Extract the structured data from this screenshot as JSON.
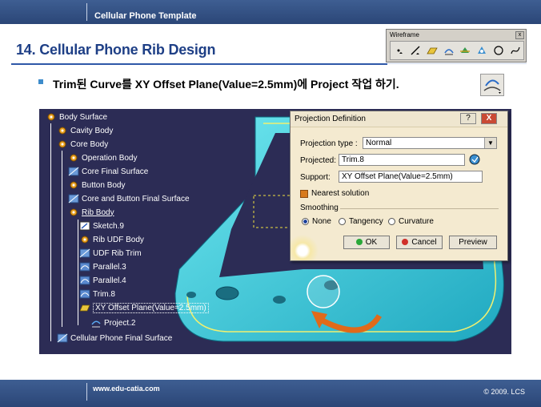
{
  "header": {
    "title": "Cellular Phone Template"
  },
  "page": {
    "heading": "14. Cellular Phone Rib Design"
  },
  "wireframe_toolbar": {
    "title": "Wireframe",
    "tools": [
      "point-icon",
      "line-icon",
      "axis-icon",
      "plane-icon",
      "projection-icon",
      "intersection-icon",
      "parallel-curve-icon",
      "circle-icon",
      "spline-icon"
    ]
  },
  "instruction": "Trim된 Curve를 XY Offset Plane(Value=2.5mm)에 Project 작업 하기.",
  "tree": {
    "items": [
      {
        "label": "Body Surface",
        "depth": 0,
        "icon": "gear-body-icon"
      },
      {
        "label": "Cavity Body",
        "depth": 1,
        "icon": "gear-body-icon"
      },
      {
        "label": "Core Body",
        "depth": 1,
        "icon": "gear-body-icon"
      },
      {
        "label": "Operation Body",
        "depth": 2,
        "icon": "gear-body-icon"
      },
      {
        "label": "Core Final Surface",
        "depth": 2,
        "icon": "surface-icon"
      },
      {
        "label": "Button Body",
        "depth": 2,
        "icon": "gear-body-icon"
      },
      {
        "label": "Core and Button Final Surface",
        "depth": 2,
        "icon": "surface-icon"
      },
      {
        "label": "Rib Body",
        "depth": 2,
        "icon": "gear-body-icon",
        "underline": true
      },
      {
        "label": "Sketch.9",
        "depth": 3,
        "icon": "sketch-icon"
      },
      {
        "label": "Rib UDF Body",
        "depth": 3,
        "icon": "gear-body-icon"
      },
      {
        "label": "UDF Rib Trim",
        "depth": 3,
        "icon": "surface-icon"
      },
      {
        "label": "Parallel.3",
        "depth": 3,
        "icon": "curve-icon"
      },
      {
        "label": "Parallel.4",
        "depth": 3,
        "icon": "curve-icon"
      },
      {
        "label": "Trim.8",
        "depth": 3,
        "icon": "curve-icon"
      },
      {
        "label": "XY Offset Plane(Value=2.5mm)",
        "depth": 3,
        "icon": "plane-icon",
        "boxed": true
      },
      {
        "label": "Project.2",
        "depth": 3,
        "icon": "projection-icon"
      },
      {
        "label": "Cellular Phone Final Surface",
        "depth": 1,
        "icon": "surface-icon"
      }
    ]
  },
  "dialog": {
    "title": "Projection Definition",
    "help_label": "?",
    "close_label": "X",
    "projection_type_label": "Projection type :",
    "projection_type_value": "Normal",
    "projected_label": "Projected:",
    "projected_value": "Trim.8",
    "support_label": "Support:",
    "support_value": "XY Offset Plane(Value=2.5mm)",
    "nearest_label": "Nearest solution",
    "smoothing_label": "Smoothing",
    "smoothing_options": [
      "None",
      "Tangency",
      "Curvature"
    ],
    "smoothing_selected": "None",
    "ok_label": "OK",
    "cancel_label": "Cancel",
    "preview_label": "Preview"
  },
  "footer": {
    "url": "www.edu-catia.com",
    "copyright": "© 2009. LCS"
  },
  "colors": {
    "header_bar": "#344f82",
    "heading": "#1e3f86",
    "canvas_bg": "#2c2c55",
    "model_cyan": "#3ad4e0",
    "arrow_orange": "#e06a1a"
  }
}
